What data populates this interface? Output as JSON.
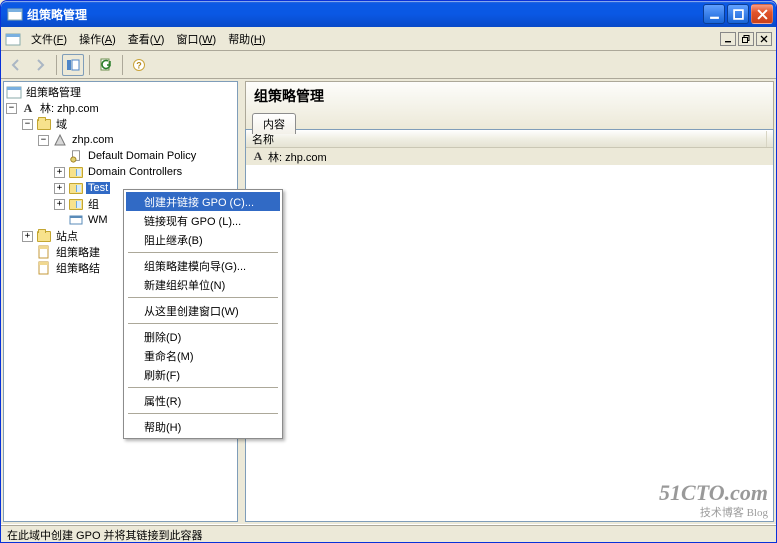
{
  "window": {
    "title": "组策略管理"
  },
  "menus": {
    "file": {
      "label": "文件",
      "hk": "F"
    },
    "action": {
      "label": "操作",
      "hk": "A"
    },
    "view": {
      "label": "查看",
      "hk": "V"
    },
    "window": {
      "label": "窗口",
      "hk": "W"
    },
    "help": {
      "label": "帮助",
      "hk": "H"
    }
  },
  "tree": {
    "root": "组策略管理",
    "forest": "林: zhp.com",
    "domains": "域",
    "domain_name": "zhp.com",
    "default_policy": "Default Domain Policy",
    "domain_controllers": "Domain Controllers",
    "test": "Test",
    "ou2_prefix": "组",
    "wmi": "WM",
    "sites": "站点",
    "gpo_model": "组策略建",
    "gpo_result": "组策略结"
  },
  "context_menu": {
    "items": [
      {
        "label": "创建并链接 GPO (C)...",
        "hl": true
      },
      {
        "label": "链接现有 GPO (L)..."
      },
      {
        "label": "阻止继承(B)"
      },
      {
        "sep": true
      },
      {
        "label": "组策略建模向导(G)..."
      },
      {
        "label": "新建组织单位(N)"
      },
      {
        "sep": true
      },
      {
        "label": "从这里创建窗口(W)"
      },
      {
        "sep": true
      },
      {
        "label": "删除(D)"
      },
      {
        "label": "重命名(M)"
      },
      {
        "label": "刷新(F)"
      },
      {
        "sep": true
      },
      {
        "label": "属性(R)"
      },
      {
        "sep": true
      },
      {
        "label": "帮助(H)"
      }
    ]
  },
  "right": {
    "heading": "组策略管理",
    "tab": "内容",
    "column": "名称",
    "row0": "林: zhp.com"
  },
  "status": "在此域中创建 GPO 并将其链接到此容器",
  "watermark": {
    "big": "51CTO.com",
    "small": "技术博客  Blog"
  }
}
